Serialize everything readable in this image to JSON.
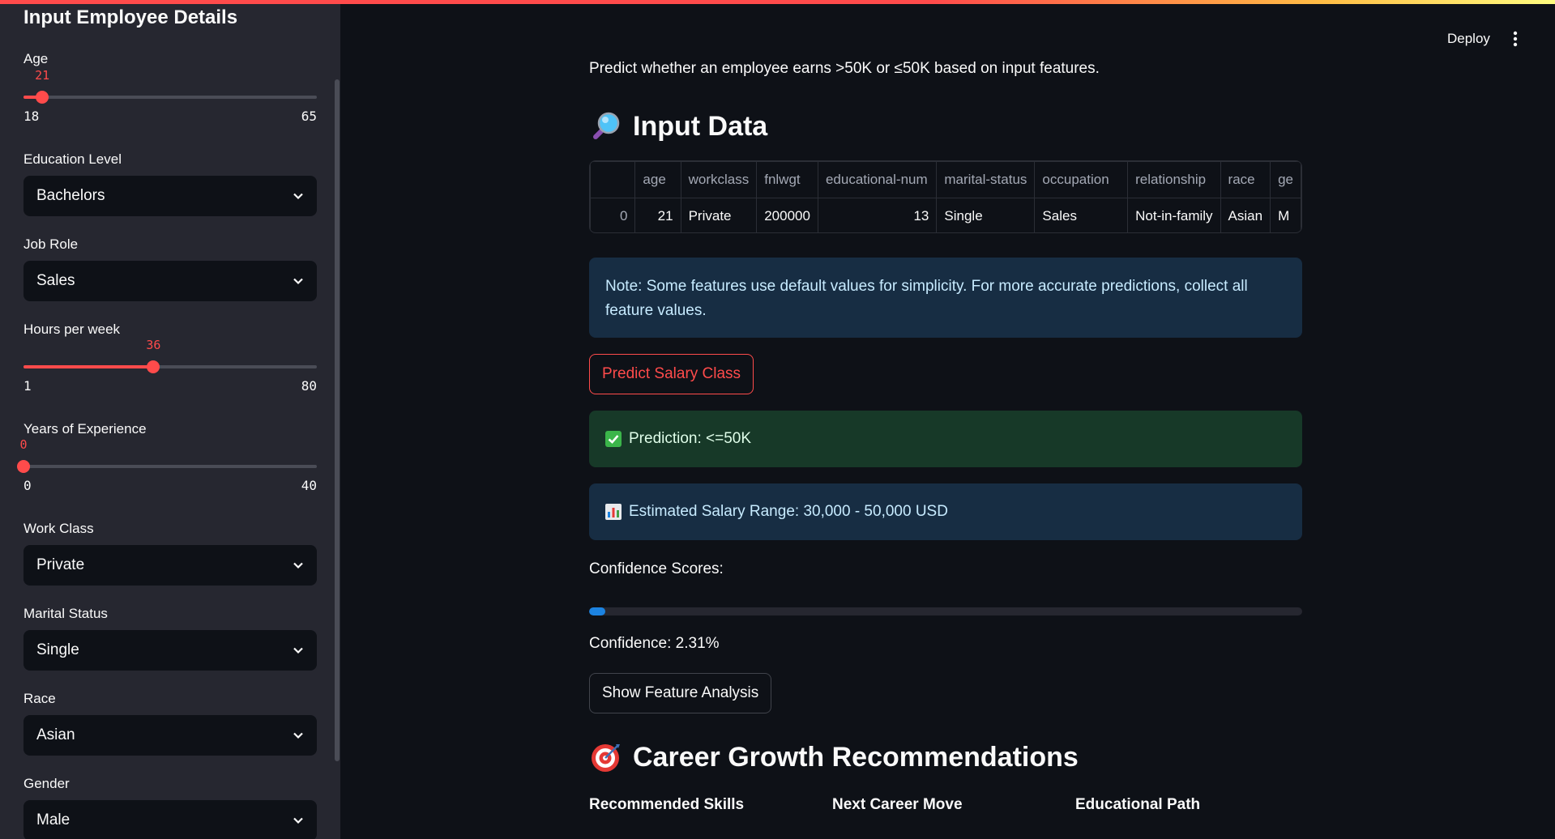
{
  "sidebar": {
    "title": "Input Employee Details",
    "age": {
      "label": "Age",
      "value": "21",
      "min": "18",
      "max": "65",
      "fraction": 0.0638
    },
    "education": {
      "label": "Education Level",
      "value": "Bachelors"
    },
    "job_role": {
      "label": "Job Role",
      "value": "Sales"
    },
    "hours": {
      "label": "Hours per week",
      "value": "36",
      "min": "1",
      "max": "80",
      "fraction": 0.443
    },
    "experience": {
      "label": "Years of Experience",
      "value": "0",
      "min": "0",
      "max": "40",
      "fraction": 0
    },
    "work_class": {
      "label": "Work Class",
      "value": "Private"
    },
    "marital": {
      "label": "Marital Status",
      "value": "Single"
    },
    "race": {
      "label": "Race",
      "value": "Asian"
    },
    "gender": {
      "label": "Gender",
      "value": "Male"
    }
  },
  "header": {
    "deploy_label": "Deploy",
    "menu_icon": "kebab-menu-icon"
  },
  "main": {
    "intro": "Predict whether an employee earns >50K or ≤50K based on input features.",
    "input_heading": "Input Data",
    "input_icon": "magnifying-glass-icon",
    "table": {
      "columns": [
        "",
        "age",
        "workclass",
        "fnlwgt",
        "educational-num",
        "marital-status",
        "occupation",
        "relationship",
        "race",
        "ge"
      ],
      "rows": [
        [
          "0",
          "21",
          "Private",
          "200000",
          "13",
          "Single",
          "Sales",
          "Not-in-family",
          "Asian",
          "M"
        ]
      ]
    },
    "note": "Note: Some features use default values for simplicity. For more accurate predictions, collect all feature values.",
    "predict_button": "Predict Salary Class",
    "prediction": "Prediction: <=50K",
    "prediction_icon": "check-mark-icon",
    "salary_range": "Estimated Salary Range: 30,000 - 50,000 USD",
    "salary_icon": "bar-chart-icon",
    "confidence_label": "Confidence Scores:",
    "confidence_fraction": 0.0231,
    "confidence_text": "Confidence: 2.31%",
    "feature_button": "Show Feature Analysis",
    "career_heading": "Career Growth Recommendations",
    "career_icon": "target-icon",
    "columns": [
      "Recommended Skills",
      "Next Career Move",
      "Educational Path"
    ]
  },
  "colors": {
    "accent": "#ff4b4b",
    "info_bg": "#172d43",
    "success_bg": "#173928",
    "progress": "#1c83e1"
  }
}
